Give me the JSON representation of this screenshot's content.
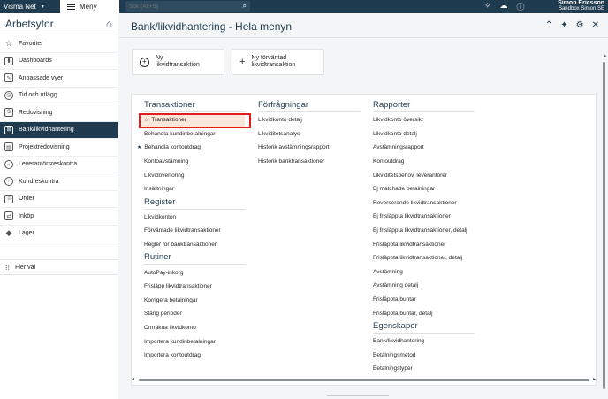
{
  "topbar": {
    "brand": "Visma Net",
    "menu_label": "Meny",
    "search_placeholder": "Sök (Alt+S)",
    "user_name": "Simon Ericsson",
    "user_company": "Sandbox Simon SE"
  },
  "sidebar": {
    "title": "Arbetsytor",
    "items": [
      {
        "label": "Favoriter",
        "icon": "star-icon"
      },
      {
        "label": "Dashboards",
        "icon": "chart-icon"
      },
      {
        "label": "Anpassade vyer",
        "icon": "custom-view-icon"
      },
      {
        "label": "Tid och utlägg",
        "icon": "time-icon"
      },
      {
        "label": "Redovisning",
        "icon": "ledger-icon"
      },
      {
        "label": "Bank/likvidhantering",
        "icon": "bank-icon"
      },
      {
        "label": "Projektredovisning",
        "icon": "project-icon"
      },
      {
        "label": "Leverantörsreskontra",
        "icon": "minus-circle-icon"
      },
      {
        "label": "Kundreskontra",
        "icon": "plus-circle-icon"
      },
      {
        "label": "Order",
        "icon": "order-icon"
      },
      {
        "label": "Inköp",
        "icon": "purchase-icon"
      },
      {
        "label": "Lager",
        "icon": "inventory-icon"
      }
    ],
    "more_label": "Fler val"
  },
  "main": {
    "title": "Bank/likvidhantering - Hela menyn",
    "actions": [
      {
        "label_line1": "Ny",
        "label_line2": "likvidtransaktion"
      },
      {
        "label_line1": "Ny förväntad",
        "label_line2": "likvidtransaktion"
      }
    ]
  },
  "menu": {
    "transaktioner": {
      "heading": "Transaktioner",
      "items": [
        "Transaktioner",
        "Behandla kundinbetalningar",
        "Behandla kontoutdrag",
        "Kontoavstämning",
        "Likvidöverföring",
        "Insättningar"
      ]
    },
    "register": {
      "heading": "Register",
      "items": [
        "Likvidkonton",
        "Förväntade likvidtransaktioner",
        "Regler för banktransaktioner"
      ]
    },
    "rutiner": {
      "heading": "Rutiner",
      "items": [
        "AutoPay-inkorg",
        "Frisläpp likvidtransaktioner",
        "Korrigera betalningar",
        "Stäng perioder",
        "Omräkna likvidkonto",
        "Importera kundinbetalningar",
        "Importera kontoutdrag"
      ]
    },
    "forfragningar": {
      "heading": "Förfrågningar",
      "items": [
        "Likvidkonto detalj",
        "Likviditetsanalys",
        "Historik avstämningsrapport",
        "Historik banktransaktioner"
      ]
    },
    "rapporter": {
      "heading": "Rapporter",
      "items": [
        "Likvidkonto översikt",
        "Likvidkonto detalj",
        "Avstämningsrapport",
        "Kontoutdrag",
        "Likviditetsbehov, leverantörer",
        "Ej matchade betalningar",
        "Reverserande likvidtransaktioner",
        "Ej frisläppta likvidtransaktioner",
        "Ej frisläppta likvidtransaktioner, detalj",
        "Frisläppta likvidtransaktioner",
        "Frisläppta likvidtransaktioner, detalj",
        "Avstämning",
        "Avstämning detalj",
        "Frisläppta buntar",
        "Frisläppta buntar, detalj"
      ]
    },
    "egenskaper": {
      "heading": "Egenskaper",
      "items": [
        "Bank/likvidhantering",
        "Betalningsmetod",
        "Betalningstyper"
      ]
    }
  }
}
